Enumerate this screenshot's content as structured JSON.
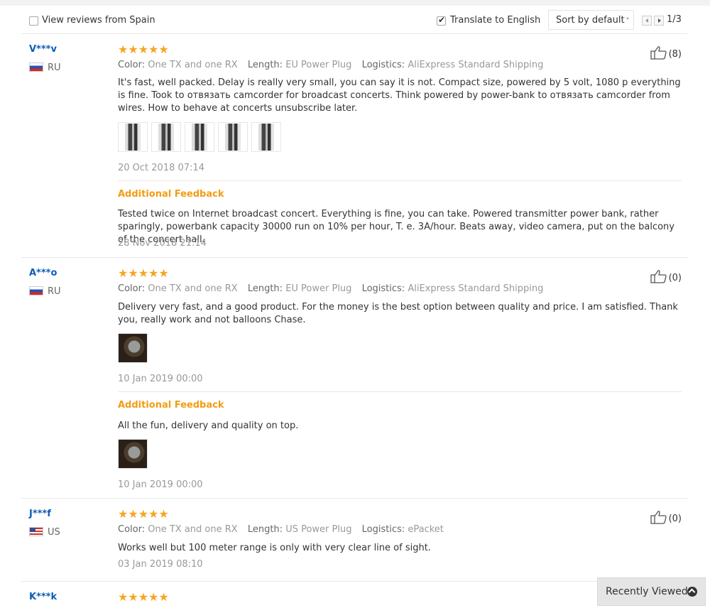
{
  "toolbar": {
    "view_from_label": "View reviews from Spain",
    "view_from_checked": false,
    "translate_label": "Translate to English",
    "translate_checked": true,
    "sort_label": "Sort by default",
    "page_indicator": "1/3"
  },
  "labels": {
    "color": "Color:",
    "length": "Length:",
    "logistics": "Logistics:",
    "additional_feedback": "Additional Feedback"
  },
  "reviews": [
    {
      "user": "V***v",
      "country": "RU",
      "rating": 5,
      "stars": "★★★★★",
      "color": "One TX and one RX",
      "length": "EU Power Plug",
      "logistics": "AliExpress Standard Shipping",
      "text": "It's fast, well packed. Delay is really very small, you can say it is not. Compact size, powered by 5 volt, 1080 p everything is fine. Took to отвязать camcorder for broadcast concerts. Think powered by power-bank to отвязать camcorder from wires. How to behave at concerts unsubscribe later.",
      "date": "20 Oct 2018 07:14",
      "likes": "(8)",
      "additional_text": "Tested twice on Internet broadcast concert. Everything is fine, you can take. Powered transmitter power bank, rather sparingly, powerbank capacity 30000 run on 10% per hour, T. e. 3A/hour. Beats away, video camera, put on the balcony of the concert hall.",
      "additional_date": "28 Nov 2018 21:14"
    },
    {
      "user": "A***o",
      "country": "RU",
      "rating": 5,
      "stars": "★★★★★",
      "color": "One TX and one RX",
      "length": "EU Power Plug",
      "logistics": "AliExpress Standard Shipping",
      "text": "Delivery very fast, and a good product. For the money is the best option between quality and price. I am satisfied. Thank you, really work and not balloons Chase.",
      "date": "10 Jan 2019 00:00",
      "likes": "(0)",
      "additional_text": "All the fun, delivery and quality on top.",
      "additional_date": "10 Jan 2019 00:00"
    },
    {
      "user": "J***f",
      "country": "US",
      "rating": 5,
      "stars": "★★★★★",
      "color": "One TX and one RX",
      "length": "US Power Plug",
      "logistics": "ePacket",
      "text": "Works well but 100 meter range is only with very clear line of sight.",
      "date": "03 Jan 2019 08:10",
      "likes": "(0)"
    },
    {
      "user": "K***k",
      "rating": 5,
      "stars": "★★★★★"
    }
  ],
  "recently_viewed": "Recently Viewed"
}
